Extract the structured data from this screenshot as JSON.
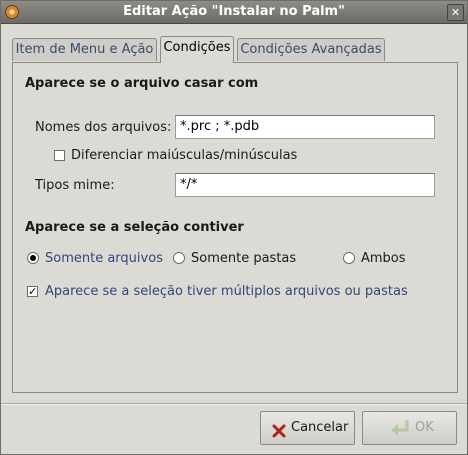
{
  "window": {
    "title": "Editar Ação \"Instalar no Palm\"",
    "close_glyph": "✕"
  },
  "tabs": [
    {
      "label": "Item de Menu e Ação",
      "active": false
    },
    {
      "label": "Condições",
      "active": true
    },
    {
      "label": "Condições Avançadas",
      "active": false
    }
  ],
  "conditions": {
    "file_match_heading": "Aparece se o arquivo casar com",
    "filenames_label": "Nomes dos arquivos:",
    "filenames_value": "*.prc ; *.pdb",
    "case_sensitive_label": "Diferenciar maiúsculas/minúsculas",
    "case_sensitive_checked": false,
    "mime_label": "Tipos mime:",
    "mime_value": "*/*",
    "selection_heading": "Aparece se a seleção contiver",
    "radio_files_label": "Somente arquivos",
    "radio_folders_label": "Somente pastas",
    "radio_both_label": "Ambos",
    "selected_radio": "files",
    "multiple_label": "Aparece se a seleção tiver múltiplos arquivos ou pastas",
    "multiple_checked": true,
    "check_glyph": "✓"
  },
  "buttons": {
    "cancel_label": "Cancelar",
    "ok_label": "OK",
    "ok_enabled": false
  },
  "colors": {
    "accent_text": "#34467a",
    "titlebar": "#7b7974"
  },
  "icons": {
    "title": "app-gear-icon",
    "cancel": "x-cancel-icon",
    "ok": "green-return-arrow-icon"
  }
}
